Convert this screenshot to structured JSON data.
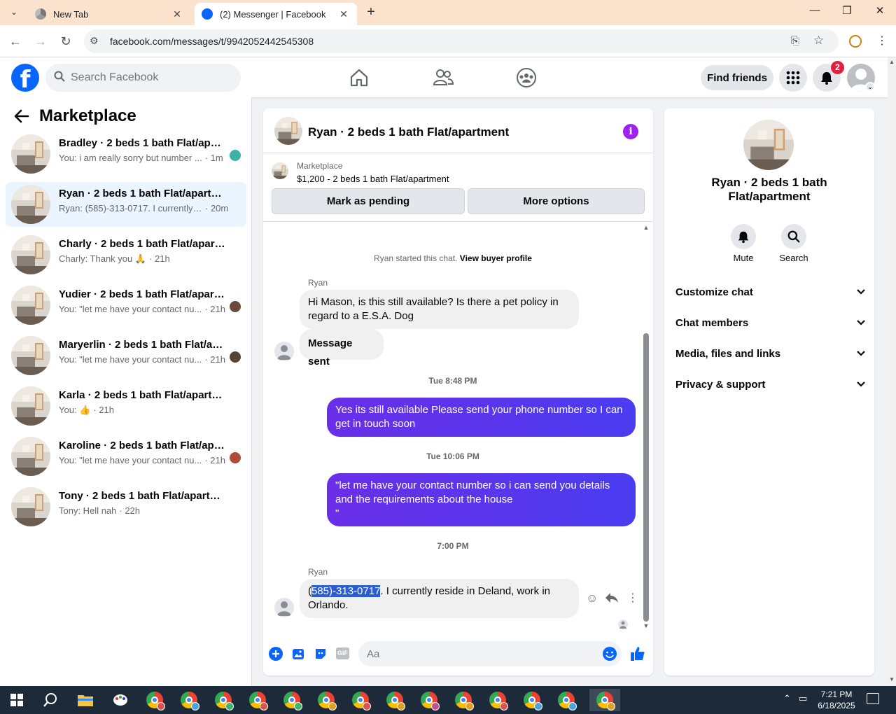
{
  "browser": {
    "tabs": [
      {
        "title": "New Tab",
        "active": false
      },
      {
        "title": "(2) Messenger | Facebook",
        "active": true
      }
    ],
    "url": "facebook.com/messages/t/9942052442545308"
  },
  "fb_header": {
    "search_placeholder": "Search Facebook",
    "find_friends": "Find friends",
    "notification_count": "2"
  },
  "sidebar": {
    "title": "Marketplace",
    "conversations": [
      {
        "name": "Bradley · 2 beds 1 bath Flat/apartment",
        "preview": "You: i am really sorry but number ...",
        "time": "· 1m",
        "selected": false
      },
      {
        "name": "Ryan · 2 beds 1 bath Flat/apartment",
        "preview": "Ryan: (585)-313-0717. I currently res...",
        "time": "· 20m",
        "selected": true
      },
      {
        "name": "Charly · 2 beds 1 bath Flat/apartment",
        "preview": "Charly: Thank you 🙏",
        "time": "· 21h",
        "selected": false
      },
      {
        "name": "Yudier · 2 beds 1 bath Flat/apartment",
        "preview": "You: \"let me have your contact nu...",
        "time": "· 21h",
        "selected": false
      },
      {
        "name": "Maryerlin · 2 beds 1 bath Flat/apartment",
        "preview": "You: \"let me have your contact nu...",
        "time": "· 21h",
        "selected": false
      },
      {
        "name": "Karla · 2 beds 1 bath Flat/apartment",
        "preview": "You: 👍",
        "time": "· 21h",
        "selected": false
      },
      {
        "name": "Karoline · 2 beds 1 bath Flat/apartment",
        "preview": "You: \"let me have your contact nu...",
        "time": "· 21h",
        "selected": false
      },
      {
        "name": "Tony · 2 beds 1 bath Flat/apartment",
        "preview": "Tony: Hell nah",
        "time": "· 22h",
        "selected": false
      }
    ]
  },
  "chat": {
    "title": "Ryan · 2 beds 1 bath Flat/apartment",
    "listing_label": "Marketplace",
    "listing_title": "$1,200 - 2 beds 1 bath Flat/apartment",
    "mark_pending": "Mark as pending",
    "more_options": "More options",
    "started_text": "Ryan started this chat.",
    "view_profile": "View buyer profile",
    "sender1": "Ryan",
    "msg1": "Hi Mason, is this still available? Is there a pet policy in regard to a E.S.A. Dog",
    "msg_sent": "Message sent",
    "time1": "Tue 8:48 PM",
    "msg2": "Yes its still available Please send your phone number so I can get in touch soon",
    "time2": "Tue 10:06 PM",
    "msg3": "\"let me have your contact number so i can send you details and the requirements about the house\n\"",
    "time3": "7:00 PM",
    "sender2": "Ryan",
    "msg4_pre": "(",
    "msg4_highlight": "585)-313-0717",
    "msg4_post": ". I currently reside in Deland, work in Orlando.",
    "input_placeholder": "Aa"
  },
  "right_panel": {
    "name": "Ryan · 2 beds 1 bath Flat/apartment",
    "mute": "Mute",
    "search": "Search",
    "sections": [
      "Customize chat",
      "Chat members",
      "Media, files and links",
      "Privacy & support"
    ]
  },
  "taskbar": {
    "time": "7:21 PM",
    "date": "6/18/2025"
  }
}
